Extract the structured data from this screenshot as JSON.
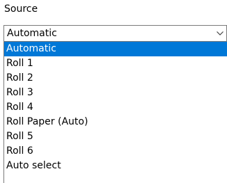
{
  "field": {
    "label": "Source",
    "value": "Automatic"
  },
  "icons": {
    "dropdown": "chevron-down-icon"
  },
  "colors": {
    "selection_background": "#0078d7",
    "selection_text": "#ffffff",
    "border": "#7a7a7a"
  },
  "options": [
    "Automatic",
    "Roll 1",
    "Roll 2",
    "Roll 3",
    "Roll 4",
    "Roll Paper (Auto)",
    "Roll 5",
    "Roll 6",
    "Auto select"
  ],
  "highlighted_option": "Automatic"
}
